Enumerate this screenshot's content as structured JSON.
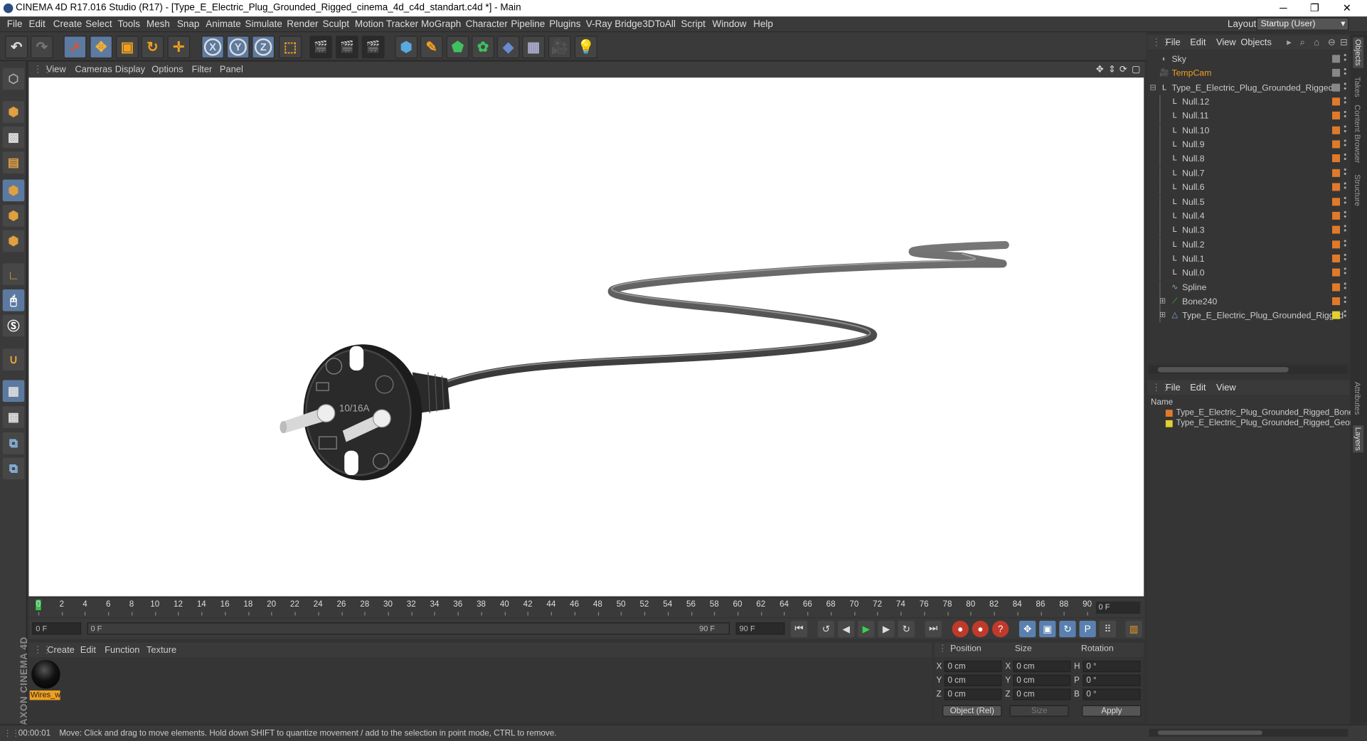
{
  "window": {
    "title": "CINEMA 4D R17.016 Studio (R17) - [Type_E_Electric_Plug_Grounded_Rigged_cinema_4d_c4d_standart.c4d *] - Main",
    "minimize": "─",
    "restore": "❐",
    "close": "✕"
  },
  "menubar": {
    "items": [
      "File",
      "Edit",
      "Create",
      "Select",
      "Tools",
      "Mesh",
      "Snap",
      "Animate",
      "Simulate",
      "Render",
      "Sculpt",
      "Motion Tracker",
      "MoGraph",
      "Character",
      "Pipeline",
      "Plugins",
      "V-Ray Bridge",
      "3DToAll",
      "Script",
      "Window",
      "Help"
    ],
    "layout_label": "Layout:",
    "layout_value": "Startup (User)"
  },
  "toolbar": {
    "axis_x": "X",
    "axis_y": "Y",
    "axis_z": "Z"
  },
  "viewport": {
    "menu": [
      "View",
      "Cameras",
      "Display",
      "Options",
      "Filter",
      "Panel"
    ],
    "plug_label": "10/16A"
  },
  "timeline": {
    "ticks": [
      "0",
      "2",
      "4",
      "6",
      "8",
      "10",
      "12",
      "14",
      "16",
      "18",
      "20",
      "22",
      "24",
      "26",
      "28",
      "30",
      "32",
      "34",
      "36",
      "38",
      "40",
      "42",
      "44",
      "46",
      "48",
      "50",
      "52",
      "54",
      "56",
      "58",
      "60",
      "62",
      "64",
      "66",
      "68",
      "70",
      "72",
      "74",
      "76",
      "78",
      "80",
      "82",
      "84",
      "86",
      "88",
      "90"
    ],
    "current_frame": "0 F",
    "start_field": "0 F",
    "range_start": "0 F",
    "range_end": "90 F",
    "end_field": "90 F"
  },
  "material_manager": {
    "menu": [
      "Create",
      "Edit",
      "Function",
      "Texture"
    ],
    "material_name": "Wires_w"
  },
  "coordinates": {
    "headers": [
      "Position",
      "Size",
      "Rotation"
    ],
    "rows": [
      {
        "axis": "X",
        "pos": "0 cm",
        "size_axis": "X",
        "size": "0 cm",
        "rot_axis": "H",
        "rot": "0 °"
      },
      {
        "axis": "Y",
        "pos": "0 cm",
        "size_axis": "Y",
        "size": "0 cm",
        "rot_axis": "P",
        "rot": "0 °"
      },
      {
        "axis": "Z",
        "pos": "0 cm",
        "size_axis": "Z",
        "size": "0 cm",
        "rot_axis": "B",
        "rot": "0 °"
      }
    ],
    "mode": "Object (Rel)",
    "size_mode": "Size",
    "apply": "Apply"
  },
  "status": {
    "time": "00:00:01",
    "message": "Move: Click and drag to move elements. Hold down SHIFT to quantize movement / add to the selection in point mode, CTRL to remove."
  },
  "object_manager": {
    "menu": [
      "File",
      "Edit",
      "View",
      "Objects"
    ],
    "objects": [
      {
        "name": "Sky",
        "indent": 0,
        "icon": "sky-icon",
        "tag": "#888888",
        "highlight": false
      },
      {
        "name": "TempCam",
        "indent": 0,
        "icon": "camera-icon",
        "tag": "#888888",
        "highlight": true
      },
      {
        "name": "Type_E_Electric_Plug_Grounded_Rigged",
        "indent": 0,
        "icon": "null-icon",
        "tag": "#888888",
        "highlight": false
      },
      {
        "name": "Null.12",
        "indent": 1,
        "icon": "null-icon",
        "tag": "#e07a2a",
        "highlight": false
      },
      {
        "name": "Null.11",
        "indent": 1,
        "icon": "null-icon",
        "tag": "#e07a2a",
        "highlight": false
      },
      {
        "name": "Null.10",
        "indent": 1,
        "icon": "null-icon",
        "tag": "#e07a2a",
        "highlight": false
      },
      {
        "name": "Null.9",
        "indent": 1,
        "icon": "null-icon",
        "tag": "#e07a2a",
        "highlight": false
      },
      {
        "name": "Null.8",
        "indent": 1,
        "icon": "null-icon",
        "tag": "#e07a2a",
        "highlight": false
      },
      {
        "name": "Null.7",
        "indent": 1,
        "icon": "null-icon",
        "tag": "#e07a2a",
        "highlight": false
      },
      {
        "name": "Null.6",
        "indent": 1,
        "icon": "null-icon",
        "tag": "#e07a2a",
        "highlight": false
      },
      {
        "name": "Null.5",
        "indent": 1,
        "icon": "null-icon",
        "tag": "#e07a2a",
        "highlight": false
      },
      {
        "name": "Null.4",
        "indent": 1,
        "icon": "null-icon",
        "tag": "#e07a2a",
        "highlight": false
      },
      {
        "name": "Null.3",
        "indent": 1,
        "icon": "null-icon",
        "tag": "#e07a2a",
        "highlight": false
      },
      {
        "name": "Null.2",
        "indent": 1,
        "icon": "null-icon",
        "tag": "#e07a2a",
        "highlight": false
      },
      {
        "name": "Null.1",
        "indent": 1,
        "icon": "null-icon",
        "tag": "#e07a2a",
        "highlight": false
      },
      {
        "name": "Null.0",
        "indent": 1,
        "icon": "null-icon",
        "tag": "#e07a2a",
        "highlight": false
      },
      {
        "name": "Spline",
        "indent": 1,
        "icon": "spline-icon",
        "tag": "#e07a2a",
        "highlight": false
      },
      {
        "name": "Bone240",
        "indent": 1,
        "icon": "bone-icon",
        "tag": "#e07a2a",
        "highlight": false
      },
      {
        "name": "Type_E_Electric_Plug_Grounded_Rigged",
        "indent": 1,
        "icon": "polygon-icon",
        "tag": "#e0d030",
        "highlight": false
      }
    ]
  },
  "layer_manager": {
    "menu": [
      "File",
      "Edit",
      "View"
    ],
    "column": "Name",
    "layers": [
      {
        "name": "Type_E_Electric_Plug_Grounded_Rigged_Bones",
        "color": "#e07a2a"
      },
      {
        "name": "Type_E_Electric_Plug_Grounded_Rigged_Geome",
        "color": "#e0d030"
      }
    ]
  },
  "right_tabs": [
    "Objects",
    "Takes",
    "Content Browser",
    "Structure",
    "Attributes",
    "Layers"
  ],
  "colors": {
    "accent_blue": "#5d7aa0",
    "highlight_orange": "#f0a020",
    "play_green": "#38d14c"
  }
}
